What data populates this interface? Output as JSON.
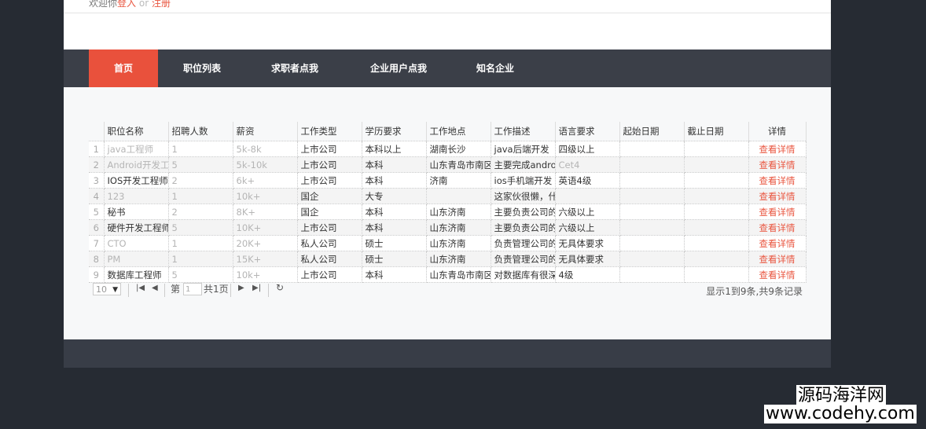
{
  "header": {
    "welcome": "欢迎你",
    "login": "登入",
    "or": "or",
    "register": "注册"
  },
  "nav": {
    "items": [
      {
        "label": "首页",
        "active": true
      },
      {
        "label": "职位列表",
        "active": false
      },
      {
        "label": "求职者点我",
        "active": false
      },
      {
        "label": "企业用户点我",
        "active": false
      },
      {
        "label": "知名企业",
        "active": false
      }
    ]
  },
  "table": {
    "columns": [
      "职位名称",
      "招聘人数",
      "薪资",
      "工作类型",
      "学历要求",
      "工作地点",
      "工作描述",
      "语言要求",
      "起始日期",
      "截止日期",
      "详情"
    ],
    "rows": [
      {
        "num": "1",
        "name": "java工程师",
        "count": "1",
        "salary": "5k-8k",
        "type": "上市公司",
        "edu": "本科以上",
        "place": "湖南长沙",
        "desc": "java后端开发",
        "lang": "四级以上",
        "start": "",
        "end": "",
        "detail": "查看详情"
      },
      {
        "num": "2",
        "name": "Android开发工",
        "count": "5",
        "salary": "5k-10k",
        "type": "上市公司",
        "edu": "本科",
        "place": "山东青岛市南区",
        "desc": "主要完成android",
        "lang": "Cet4",
        "start": "",
        "end": "",
        "detail": "查看详情"
      },
      {
        "num": "3",
        "name": "IOS开发工程师",
        "count": "2",
        "salary": "6k+",
        "type": "上市公司",
        "edu": "本科",
        "place": "济南",
        "desc": "ios手机端开发",
        "lang": "英语4级",
        "start": "",
        "end": "",
        "detail": "查看详情"
      },
      {
        "num": "4",
        "name": "123",
        "count": "1",
        "salary": "10k+",
        "type": "国企",
        "edu": "大专",
        "place": "",
        "desc": "这家伙很懒，什",
        "lang": "",
        "start": "",
        "end": "",
        "detail": "查看详情"
      },
      {
        "num": "5",
        "name": "秘书",
        "count": "2",
        "salary": "8K+",
        "type": "国企",
        "edu": "本科",
        "place": "山东济南",
        "desc": "主要负责公司的",
        "lang": "六级以上",
        "start": "",
        "end": "",
        "detail": "查看详情"
      },
      {
        "num": "6",
        "name": "硬件开发工程师",
        "count": "5",
        "salary": "10K+",
        "type": "上市公司",
        "edu": "本科",
        "place": "山东济南",
        "desc": "主要负责公司的",
        "lang": "六级以上",
        "start": "",
        "end": "",
        "detail": "查看详情"
      },
      {
        "num": "7",
        "name": "CTO",
        "count": "1",
        "salary": "20K+",
        "type": "私人公司",
        "edu": "硕士",
        "place": "山东济南",
        "desc": "负责管理公司的",
        "lang": "无具体要求",
        "start": "",
        "end": "",
        "detail": "查看详情"
      },
      {
        "num": "8",
        "name": "PM",
        "count": "1",
        "salary": "15K+",
        "type": "私人公司",
        "edu": "硕士",
        "place": "山东济南",
        "desc": "负责管理公司的",
        "lang": "无具体要求",
        "start": "",
        "end": "",
        "detail": "查看详情"
      },
      {
        "num": "9",
        "name": "数据库工程师",
        "count": "5",
        "salary": "10k+",
        "type": "上市公司",
        "edu": "本科",
        "place": "山东青岛市南区",
        "desc": "对数据库有很深",
        "lang": "4级",
        "start": "",
        "end": "",
        "detail": "查看详情"
      }
    ]
  },
  "pager": {
    "page_size": "10",
    "page_label": "第",
    "page_value": "1",
    "total_label": "共1页",
    "info": "显示1到9条,共9条记录"
  },
  "watermark": {
    "line1": "源码海洋网",
    "line2": "www.codehy.com"
  },
  "icons": {
    "first": "first-page-icon",
    "prev": "prev-page-icon",
    "next": "next-page-icon",
    "last": "last-page-icon",
    "refresh": "refresh-icon",
    "dropdown": "chevron-down-icon"
  },
  "colors": {
    "accent": "#e9513c",
    "nav_bg": "#3b3f48",
    "body_bg": "#262b33"
  }
}
